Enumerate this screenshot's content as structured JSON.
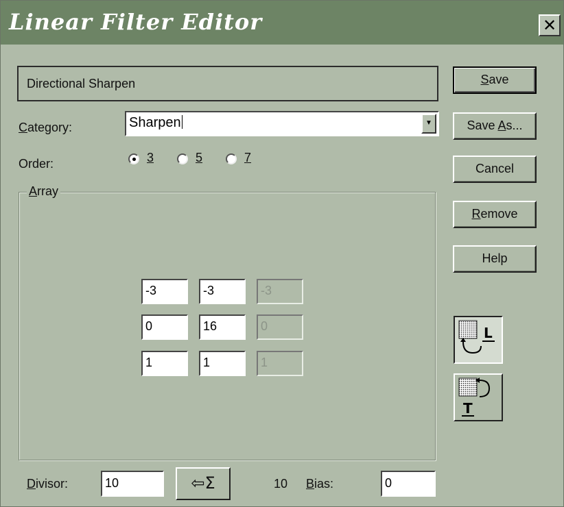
{
  "window": {
    "title": "Linear Filter Editor",
    "close_label": "✕"
  },
  "filter_name": "Directional Sharpen",
  "category": {
    "label_pre": "",
    "label_ul": "C",
    "label_post": "ategory:",
    "value": "Sharpen"
  },
  "order": {
    "label": "Order:",
    "options": [
      {
        "label": "3",
        "checked": true
      },
      {
        "label": "5",
        "checked": false
      },
      {
        "label": "7",
        "checked": false
      }
    ]
  },
  "array": {
    "label_ul": "A",
    "label_post": "rray",
    "cells": [
      [
        "-3",
        "-3",
        "-3"
      ],
      [
        "0",
        "16",
        "0"
      ],
      [
        "1",
        "1",
        "1"
      ]
    ],
    "disabled_column": 2
  },
  "buttons": {
    "save": {
      "ul": "S",
      "rest": "ave"
    },
    "save_as": {
      "pre": "Save ",
      "ul": "A",
      "rest": "s..."
    },
    "cancel": "Cancel",
    "remove": {
      "ul": "R",
      "rest": "emove"
    },
    "help": "Help"
  },
  "icons": {
    "rotate_l": "rotate-left-icon",
    "rotate_t": "rotate-top-icon"
  },
  "bottom": {
    "divisor_ul": "D",
    "divisor_rest": "ivisor:",
    "divisor_value": "10",
    "sum_button": "⇦Σ",
    "sum_value": "10",
    "bias_ul": "B",
    "bias_rest": "ias:",
    "bias_value": "0"
  }
}
